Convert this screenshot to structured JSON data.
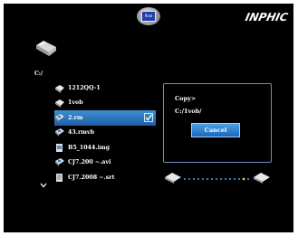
{
  "header": {
    "logo_label": "Real",
    "brand": "INPHIC"
  },
  "browser": {
    "path": "C:/",
    "items": [
      {
        "name": "1212QQ-1",
        "icon": "folder-icon"
      },
      {
        "name": "1vob",
        "icon": "folder-icon"
      },
      {
        "name": "2.rm",
        "icon": "video-file-icon",
        "selected": true,
        "checked": true
      },
      {
        "name": "43.rmvb",
        "icon": "video-file-icon"
      },
      {
        "name": "B5_1044.img",
        "icon": "image-file-icon"
      },
      {
        "name": "CJ7.200 ~.avi",
        "icon": "video-file-icon"
      },
      {
        "name": "CJ7.2008 ~.srt",
        "icon": "text-file-icon"
      }
    ]
  },
  "dialog": {
    "title": "Copy>",
    "destination": "C:/1vob/",
    "cancel_label": "Cancel"
  },
  "colors": {
    "background": "#000000",
    "selection": "#2a72bd",
    "dialog_border": "#6f8ec4",
    "button": "#2b7cd0"
  }
}
